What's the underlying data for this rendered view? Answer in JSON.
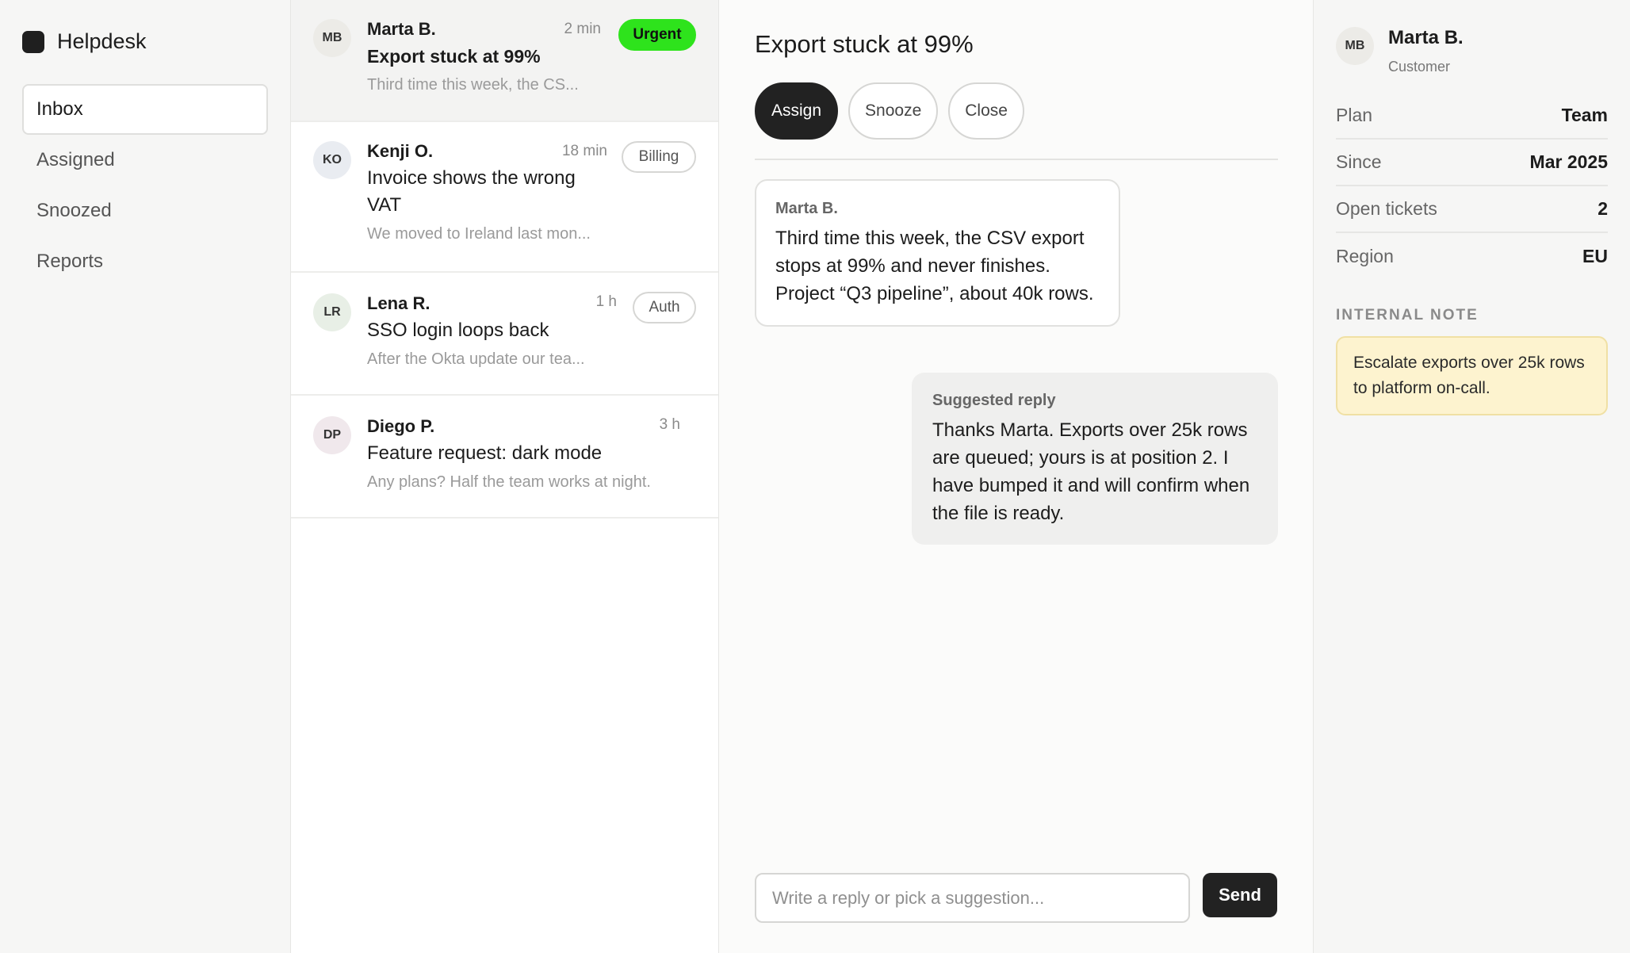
{
  "app": {
    "name": "Helpdesk"
  },
  "nav": [
    {
      "label": "Inbox",
      "active": true
    },
    {
      "label": "Assigned"
    },
    {
      "label": "Snoozed"
    },
    {
      "label": "Reports"
    }
  ],
  "tickets": [
    {
      "initials": "MB",
      "name": "Marta B.",
      "time": "2 min",
      "tag": "Urgent",
      "subject": "Export stuck at 99%",
      "preview": "Third time this week, the CS..."
    },
    {
      "initials": "KO",
      "name": "Kenji O.",
      "time": "18 min",
      "tag": "Billing",
      "subject": "Invoice shows the wrong VAT",
      "preview": "We moved to Ireland last mon..."
    },
    {
      "initials": "LR",
      "name": "Lena R.",
      "time": "1 h",
      "tag": "Auth",
      "subject": "SSO login loops back",
      "preview": "After the Okta update our tea..."
    },
    {
      "initials": "DP",
      "name": "Diego P.",
      "time": "3 h",
      "subject": "Feature request: dark mode",
      "preview": "Any plans? Half the team works at night."
    }
  ],
  "conversation": {
    "title": "Export stuck at 99%",
    "actions": {
      "assign": "Assign",
      "snooze": "Snooze",
      "close": "Close"
    },
    "message": {
      "author": "Marta B.",
      "text": "Third time this week, the CSV export stops at 99% and never finishes. Project “Q3 pipeline”, about 40k rows."
    },
    "suggestion": {
      "label": "Suggested reply",
      "text": "Thanks Marta. Exports over 25k rows are queued; yours is at position 2. I have bumped it and will confirm when the file is ready."
    },
    "composer": {
      "placeholder": "Write a reply or pick a suggestion...",
      "value": "",
      "send": "Send"
    }
  },
  "customer": {
    "initials": "MB",
    "name": "Marta B.",
    "role": "Customer",
    "properties": [
      {
        "label": "Plan",
        "value": "Team"
      },
      {
        "label": "Since",
        "value": "Mar 2025"
      },
      {
        "label": "Open tickets",
        "value": "2"
      },
      {
        "label": "Region",
        "value": "EU"
      }
    ],
    "note_heading": "INTERNAL NOTE",
    "note": "Escalate exports over 25k rows to platform on-call."
  },
  "colors": {
    "accent_dark": "#222222",
    "urgent": "#2ee31c",
    "note_bg": "#fdf3cf",
    "avatar_mb": "#ecebe7",
    "avatar_ko": "#e9ecf1",
    "avatar_lr": "#e8efe6",
    "avatar_dp": "#f0e8ec"
  }
}
